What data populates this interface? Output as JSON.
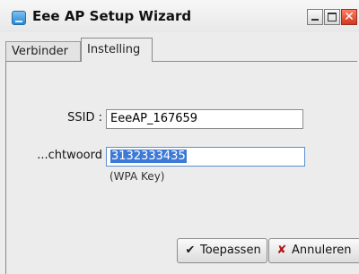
{
  "window": {
    "title": "Eee AP Setup Wizard"
  },
  "tabs": [
    {
      "label": "Verbinder",
      "active": false
    },
    {
      "label": "Instelling",
      "active": true
    }
  ],
  "form": {
    "ssid_label": "SSID :",
    "ssid_value": "EeeAP_167659",
    "password_label": "...chtwoord",
    "password_value": "3132333435",
    "password_hint": "(WPA Key)"
  },
  "buttons": {
    "apply_label": "Toepassen",
    "cancel_label": "Annuleren"
  },
  "colors": {
    "selection": "#3d7ad6",
    "close_button": "#d1391f",
    "focus_border": "#5b8fd0"
  }
}
